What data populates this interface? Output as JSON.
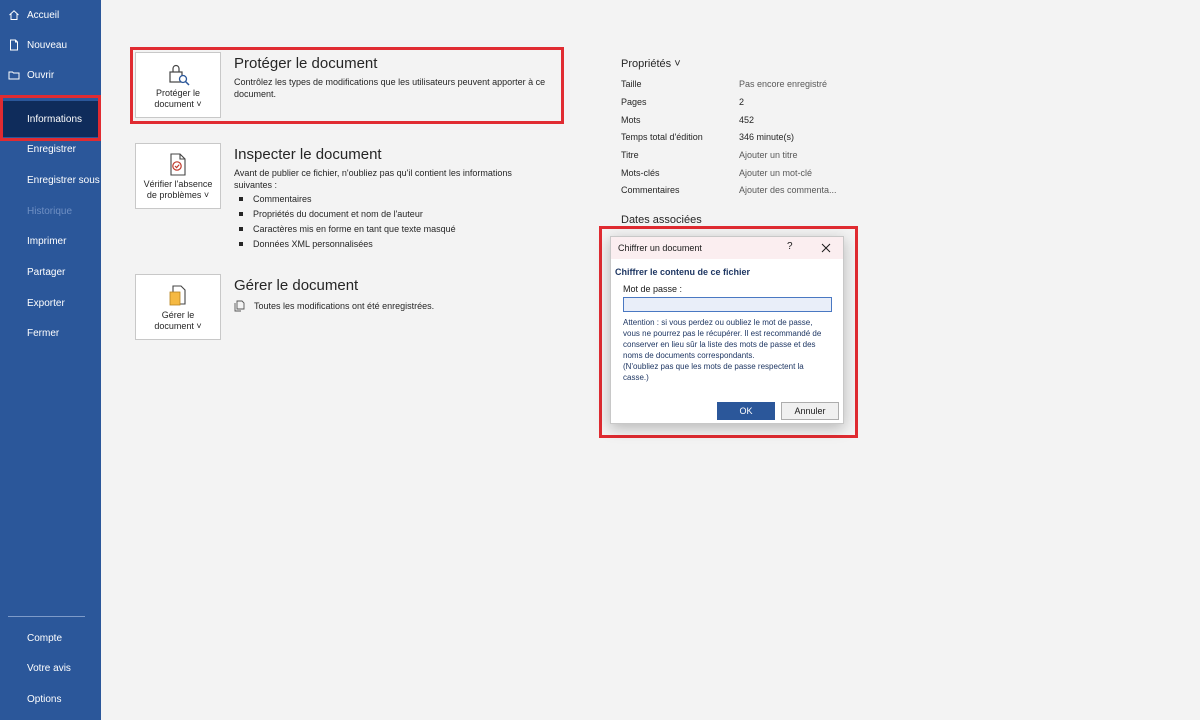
{
  "sidebar": {
    "items": [
      {
        "label": "Accueil",
        "icon": "home-icon"
      },
      {
        "label": "Nouveau",
        "icon": "new-document-icon"
      },
      {
        "label": "Ouvrir",
        "icon": "folder-icon"
      },
      {
        "label": "Informations",
        "state": "active"
      },
      {
        "label": "Enregistrer"
      },
      {
        "label": "Enregistrer sous"
      },
      {
        "label": "Historique",
        "state": "disabled"
      },
      {
        "label": "Imprimer"
      },
      {
        "label": "Partager"
      },
      {
        "label": "Exporter"
      },
      {
        "label": "Fermer"
      }
    ],
    "bottom_items": [
      {
        "label": "Compte"
      },
      {
        "label": "Votre avis"
      },
      {
        "label": "Options"
      }
    ]
  },
  "protect": {
    "tile_line1": "Protéger le",
    "tile_line2": "document ˅",
    "title": "Protéger le document",
    "description": "Contrôlez les types de modifications que les utilisateurs peuvent apporter à ce document."
  },
  "inspect": {
    "tile_line1": "Vérifier l'absence",
    "tile_line2": "de problèmes ˅",
    "title": "Inspecter le document",
    "description": "Avant de publier ce fichier, n'oubliez pas qu'il contient les informations suivantes :",
    "bullets": [
      "Commentaires",
      "Propriétés du document et nom de l'auteur",
      "Caractères mis en forme en tant que texte masqué",
      "Données XML personnalisées"
    ]
  },
  "manage": {
    "tile_line1": "Gérer le",
    "tile_line2": "document ˅",
    "title": "Gérer le document",
    "status": "Toutes les modifications ont été enregistrées."
  },
  "properties": {
    "title": "Propriétés ˅",
    "rows": [
      {
        "label": "Taille",
        "value": "Pas encore enregistré"
      },
      {
        "label": "Pages",
        "value": "2"
      },
      {
        "label": "Mots",
        "value": "452"
      },
      {
        "label": "Temps total d'édition",
        "value": "346 minute(s)"
      },
      {
        "label": "Titre",
        "value": "Ajouter un titre"
      },
      {
        "label": "Mots-clés",
        "value": "Ajouter un mot-clé"
      },
      {
        "label": "Commentaires",
        "value": "Ajouter des commenta..."
      }
    ],
    "dates_title": "Dates associées"
  },
  "dialog": {
    "title": "Chiffrer un document",
    "help": "?",
    "heading": "Chiffrer le contenu de ce fichier",
    "password_label": "Mot de passe :",
    "password_value": "",
    "warning": "Attention : si vous perdez ou oubliez le mot de passe, vous ne pourrez pas le récupérer. Il est recommandé de conserver en lieu sûr la liste des mots de passe et des noms de documents correspondants.",
    "warning2": "(N'oubliez pas que les mots de passe respectent la casse.)",
    "ok": "OK",
    "cancel": "Annuler"
  },
  "colors": {
    "sidebar_bg": "#2b579a",
    "active_item_bg": "#0f2c5b",
    "highlight": "#e02b31",
    "dialog_titlebar": "#fbeef0",
    "accent_text": "#1f3763"
  }
}
